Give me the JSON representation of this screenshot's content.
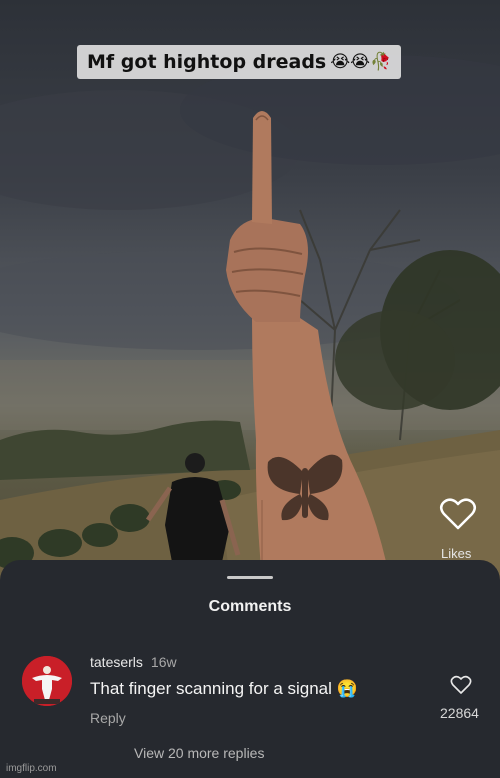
{
  "video": {
    "caption": "Mf got hightop dreads",
    "caption_emojis": "😭😭🥀",
    "likes_label": "Likes"
  },
  "comments_sheet": {
    "title": "Comments",
    "comment": {
      "username": "tateserls",
      "age": "16w",
      "text": "That finger scanning for a signal 😭",
      "reply_label": "Reply",
      "like_count": "22864"
    },
    "more_replies": "View 20 more replies"
  },
  "watermark": "imgflip.com",
  "colors": {
    "sheet_bg": "#26292f",
    "avatar_bg": "#c91f28",
    "caption_bg": "#e6e6e6"
  }
}
